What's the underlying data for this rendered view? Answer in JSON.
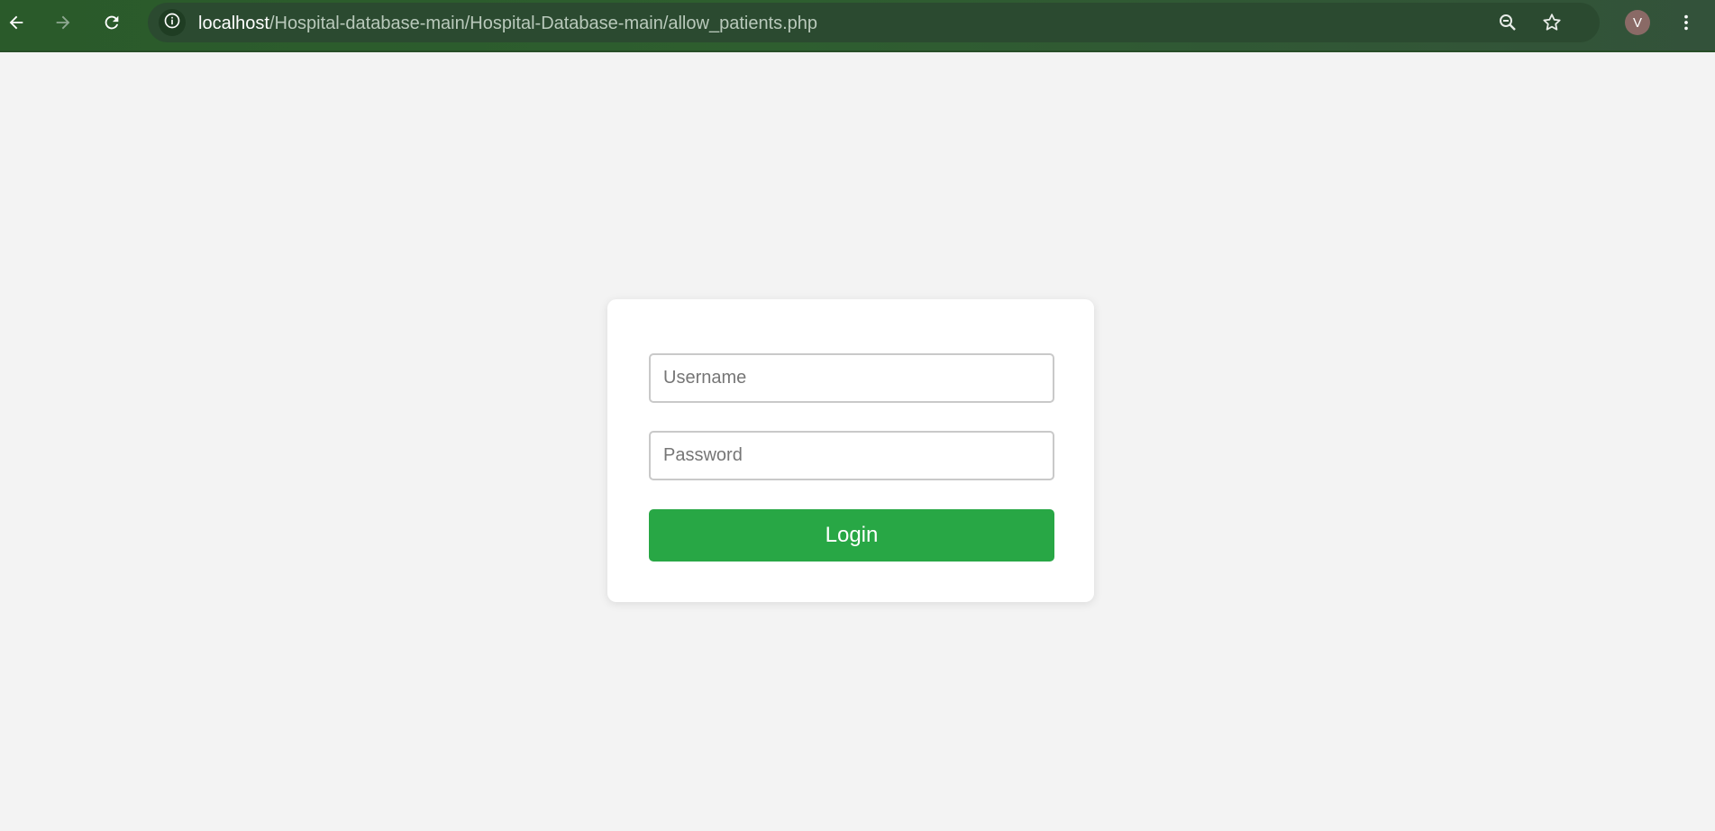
{
  "browser": {
    "url_host": "localhost",
    "url_path": "/Hospital-database-main/Hospital-Database-main/allow_patients.php",
    "profile_initial": "V",
    "icons": [
      "back-arrow-icon",
      "forward-arrow-icon",
      "reload-icon",
      "site-info-icon",
      "zoom-icon",
      "bookmark-star-icon",
      "more-vertical-icon"
    ]
  },
  "login_form": {
    "username_placeholder": "Username",
    "password_placeholder": "Password",
    "username_value": "",
    "password_value": "",
    "login_label": "Login"
  },
  "colors": {
    "toolbar": "#2e5e2f",
    "page_background": "#f3f3f3",
    "card": "#ffffff",
    "login_button": "#28a745"
  }
}
